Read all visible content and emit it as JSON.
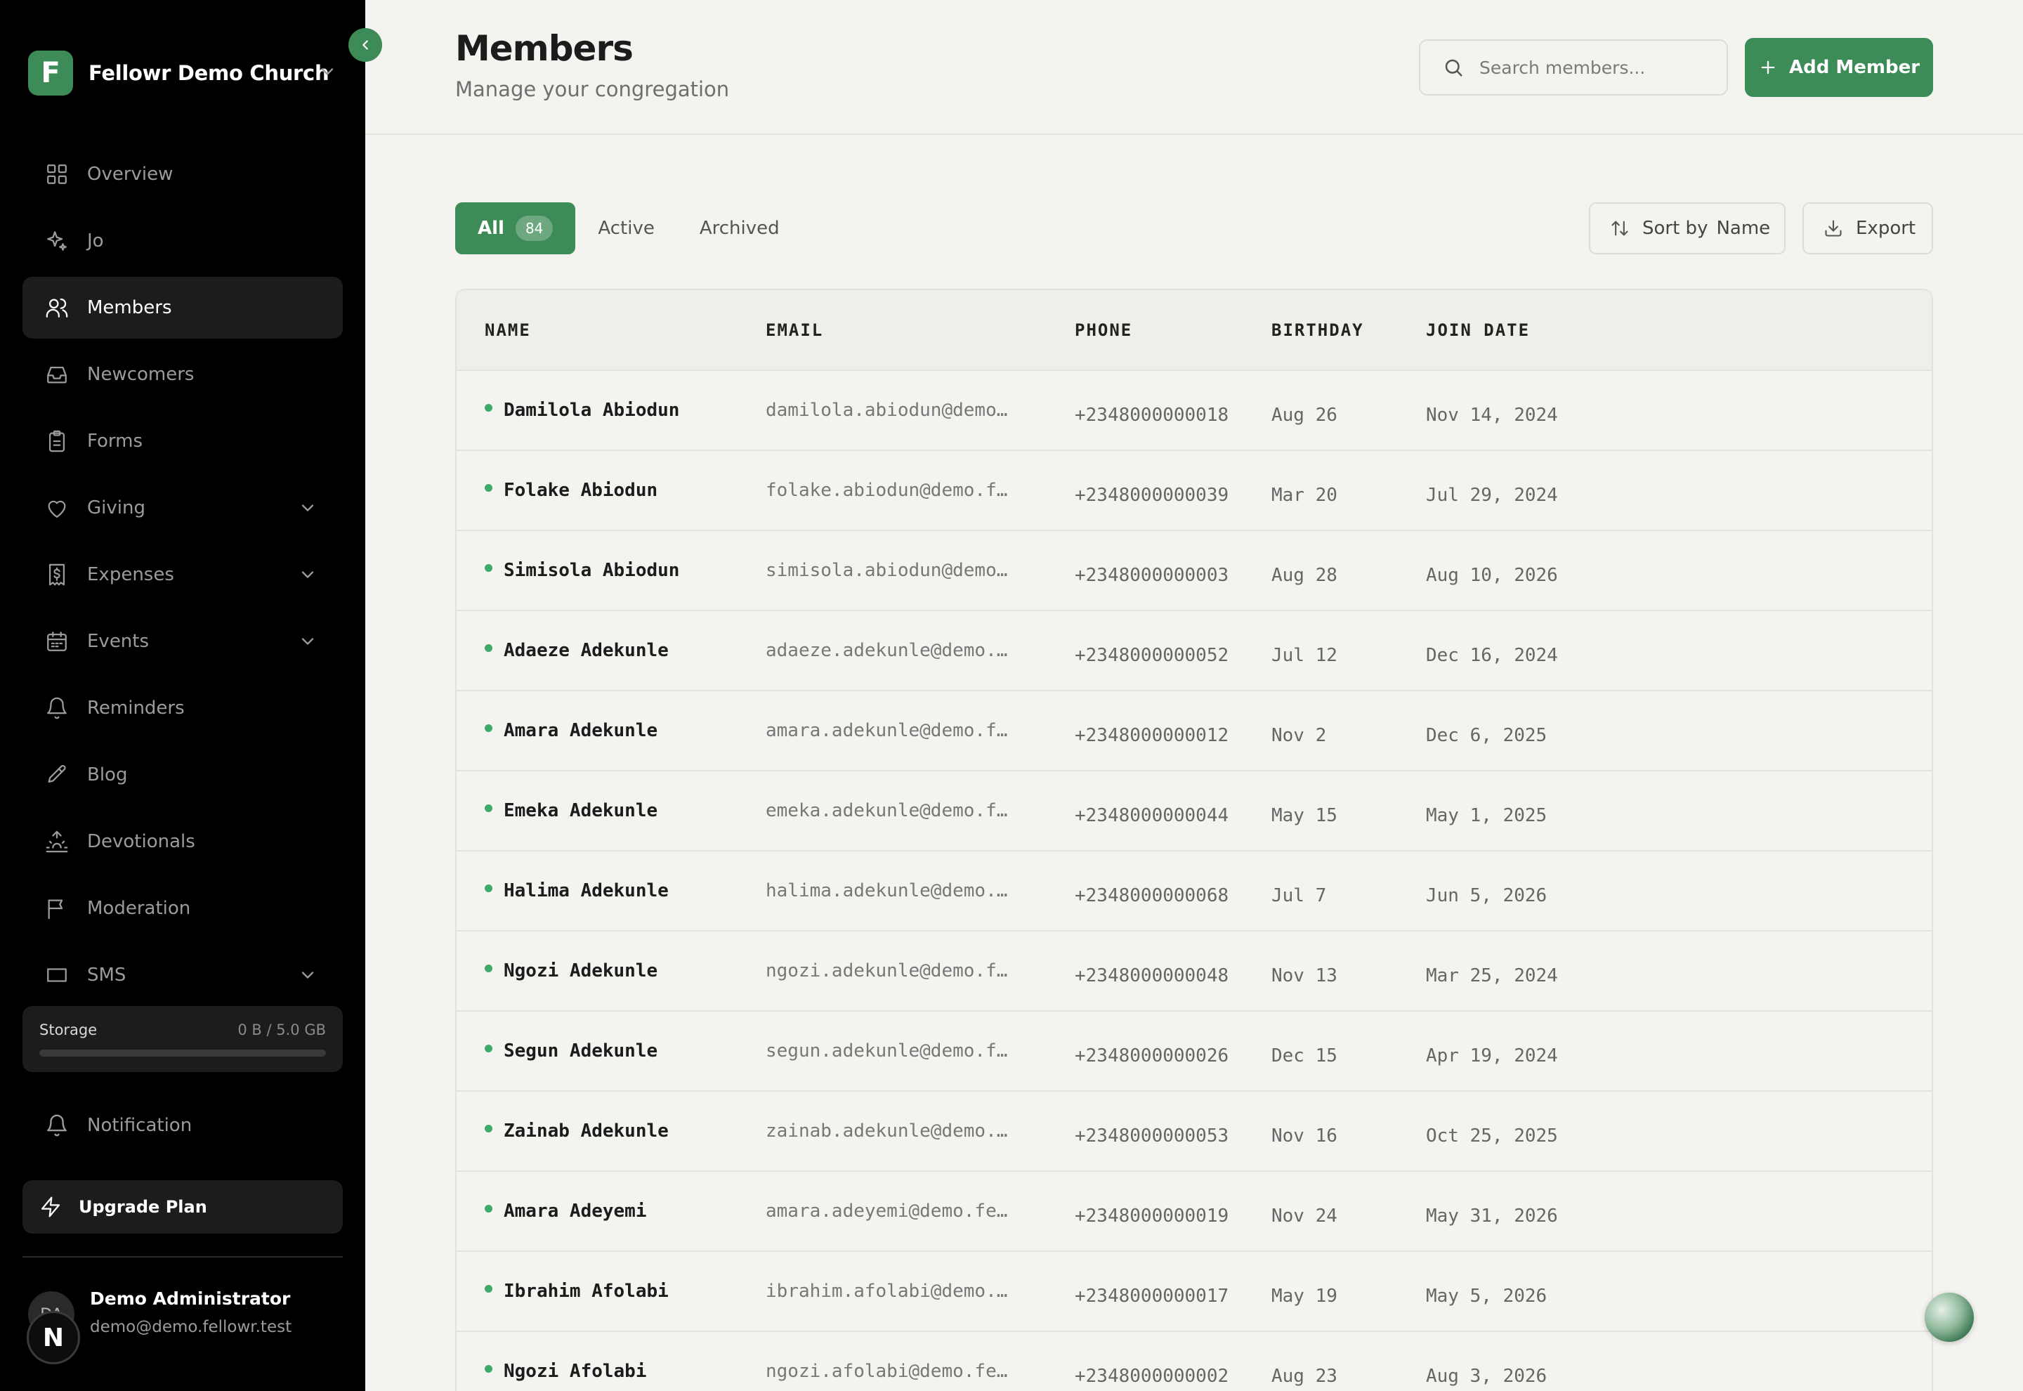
{
  "sidebar": {
    "brand": {
      "logo_letter": "F",
      "name": "Fellowr Demo Church"
    },
    "items": [
      {
        "label": "Overview",
        "icon": "grid-icon",
        "active": false,
        "has_chevron": false
      },
      {
        "label": "Jo",
        "icon": "sparkles-icon",
        "active": false,
        "has_chevron": false
      },
      {
        "label": "Members",
        "icon": "users-icon",
        "active": true,
        "has_chevron": false
      },
      {
        "label": "Newcomers",
        "icon": "inbox-icon",
        "active": false,
        "has_chevron": false
      },
      {
        "label": "Forms",
        "icon": "clipboard-icon",
        "active": false,
        "has_chevron": false
      },
      {
        "label": "Giving",
        "icon": "heart-icon",
        "active": false,
        "has_chevron": true
      },
      {
        "label": "Expenses",
        "icon": "receipt-icon",
        "active": false,
        "has_chevron": true
      },
      {
        "label": "Events",
        "icon": "calendar-icon",
        "active": false,
        "has_chevron": true
      },
      {
        "label": "Reminders",
        "icon": "bell-icon",
        "active": false,
        "has_chevron": false
      },
      {
        "label": "Blog",
        "icon": "pen-icon",
        "active": false,
        "has_chevron": false
      },
      {
        "label": "Devotionals",
        "icon": "sunrise-icon",
        "active": false,
        "has_chevron": false
      },
      {
        "label": "Moderation",
        "icon": "flag-icon",
        "active": false,
        "has_chevron": false
      },
      {
        "label": "SMS",
        "icon": "message-icon",
        "active": false,
        "has_chevron": true
      }
    ],
    "storage": {
      "label": "Storage",
      "value": "0 B / 5.0 GB",
      "fraction_used": 0
    },
    "notification_label": "Notification",
    "upgrade_label": "Upgrade Plan",
    "user": {
      "initials": "DA",
      "badge": "N",
      "name": "Demo Administrator",
      "email": "demo@demo.fellowr.test"
    }
  },
  "header": {
    "title": "Members",
    "subtitle": "Manage your congregation",
    "search_placeholder": "Search members...",
    "add_button": "Add Member"
  },
  "tabs": [
    {
      "label": "All",
      "count": "84",
      "active": true
    },
    {
      "label": "Active",
      "count": "",
      "active": false
    },
    {
      "label": "Archived",
      "count": "",
      "active": false
    }
  ],
  "toolbar": {
    "sort_label": "Sort by",
    "sort_value": "Name",
    "export_label": "Export"
  },
  "table": {
    "columns": [
      "NAME",
      "EMAIL",
      "PHONE",
      "BIRTHDAY",
      "JOIN DATE"
    ],
    "rows": [
      {
        "name": "Damilola Abiodun",
        "email": "damilola.abiodun@demo.…",
        "phone": "+2348000000018",
        "birthday": "Aug 26",
        "join": "Nov 14, 2024"
      },
      {
        "name": "Folake Abiodun",
        "email": "folake.abiodun@demo.fe…",
        "phone": "+2348000000039",
        "birthday": "Mar 20",
        "join": "Jul 29, 2024"
      },
      {
        "name": "Simisola Abiodun",
        "email": "simisola.abiodun@demo.…",
        "phone": "+2348000000003",
        "birthday": "Aug 28",
        "join": "Aug 10, 2026"
      },
      {
        "name": "Adaeze Adekunle",
        "email": "adaeze.adekunle@demo.f…",
        "phone": "+2348000000052",
        "birthday": "Jul 12",
        "join": "Dec 16, 2024"
      },
      {
        "name": "Amara Adekunle",
        "email": "amara.adekunle@demo.fe…",
        "phone": "+2348000000012",
        "birthday": "Nov 2",
        "join": "Dec 6, 2025"
      },
      {
        "name": "Emeka Adekunle",
        "email": "emeka.adekunle@demo.fe…",
        "phone": "+2348000000044",
        "birthday": "May 15",
        "join": "May 1, 2025"
      },
      {
        "name": "Halima Adekunle",
        "email": "halima.adekunle@demo.f…",
        "phone": "+2348000000068",
        "birthday": "Jul 7",
        "join": "Jun 5, 2026"
      },
      {
        "name": "Ngozi Adekunle",
        "email": "ngozi.adekunle@demo.fe…",
        "phone": "+2348000000048",
        "birthday": "Nov 13",
        "join": "Mar 25, 2024"
      },
      {
        "name": "Segun Adekunle",
        "email": "segun.adekunle@demo.fe…",
        "phone": "+2348000000026",
        "birthday": "Dec 15",
        "join": "Apr 19, 2024"
      },
      {
        "name": "Zainab Adekunle",
        "email": "zainab.adekunle@demo.f…",
        "phone": "+2348000000053",
        "birthday": "Nov 16",
        "join": "Oct 25, 2025"
      },
      {
        "name": "Amara Adeyemi",
        "email": "amara.adeyemi@demo.fel…",
        "phone": "+2348000000019",
        "birthday": "Nov 24",
        "join": "May 31, 2026"
      },
      {
        "name": "Ibrahim Afolabi",
        "email": "ibrahim.afolabi@demo.f…",
        "phone": "+2348000000017",
        "birthday": "May 19",
        "join": "May 5, 2026"
      },
      {
        "name": "Ngozi Afolabi",
        "email": "ngozi.afolabi@demo.fel…",
        "phone": "+2348000000002",
        "birthday": "Aug 23",
        "join": "Aug 3, 2026"
      }
    ]
  },
  "colors": {
    "accent": "#3d8b57",
    "sidebar_bg": "#000000",
    "page_bg": "#f4f3ef",
    "status_dot": "#3daa6a"
  }
}
